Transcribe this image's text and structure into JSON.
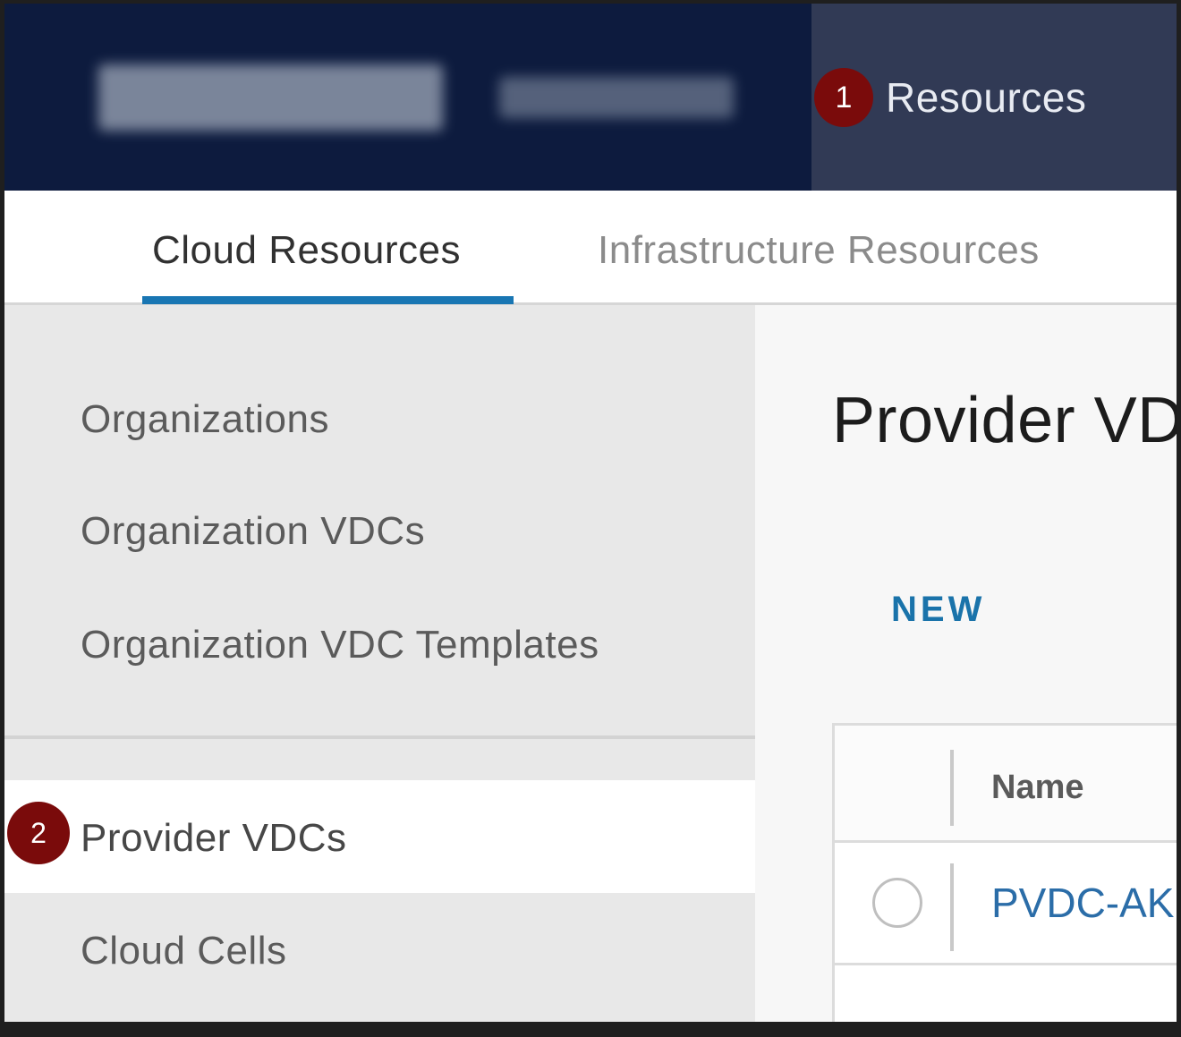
{
  "header": {
    "nav_badge": "1",
    "nav_label": "Resources"
  },
  "tabs": [
    {
      "label": "Cloud Resources",
      "active": true
    },
    {
      "label": "Infrastructure Resources",
      "active": false
    }
  ],
  "sidebar": {
    "items": [
      {
        "label": "Organizations"
      },
      {
        "label": "Organization VDCs"
      },
      {
        "label": "Organization VDC Templates"
      },
      {
        "label": "Provider VDCs",
        "badge": "2",
        "active": true
      },
      {
        "label": "Cloud Cells"
      }
    ]
  },
  "main": {
    "title": "Provider VDCs",
    "new_label": "NEW",
    "table": {
      "columns": [
        "Name"
      ],
      "rows": [
        {
          "name": "PVDC-AK"
        }
      ]
    }
  },
  "colors": {
    "header_bg": "#0d1b3e",
    "nav_active_bg": "#313a55",
    "badge": "#7a0b0b",
    "accent": "#1976b3",
    "link": "#2b6da8"
  }
}
